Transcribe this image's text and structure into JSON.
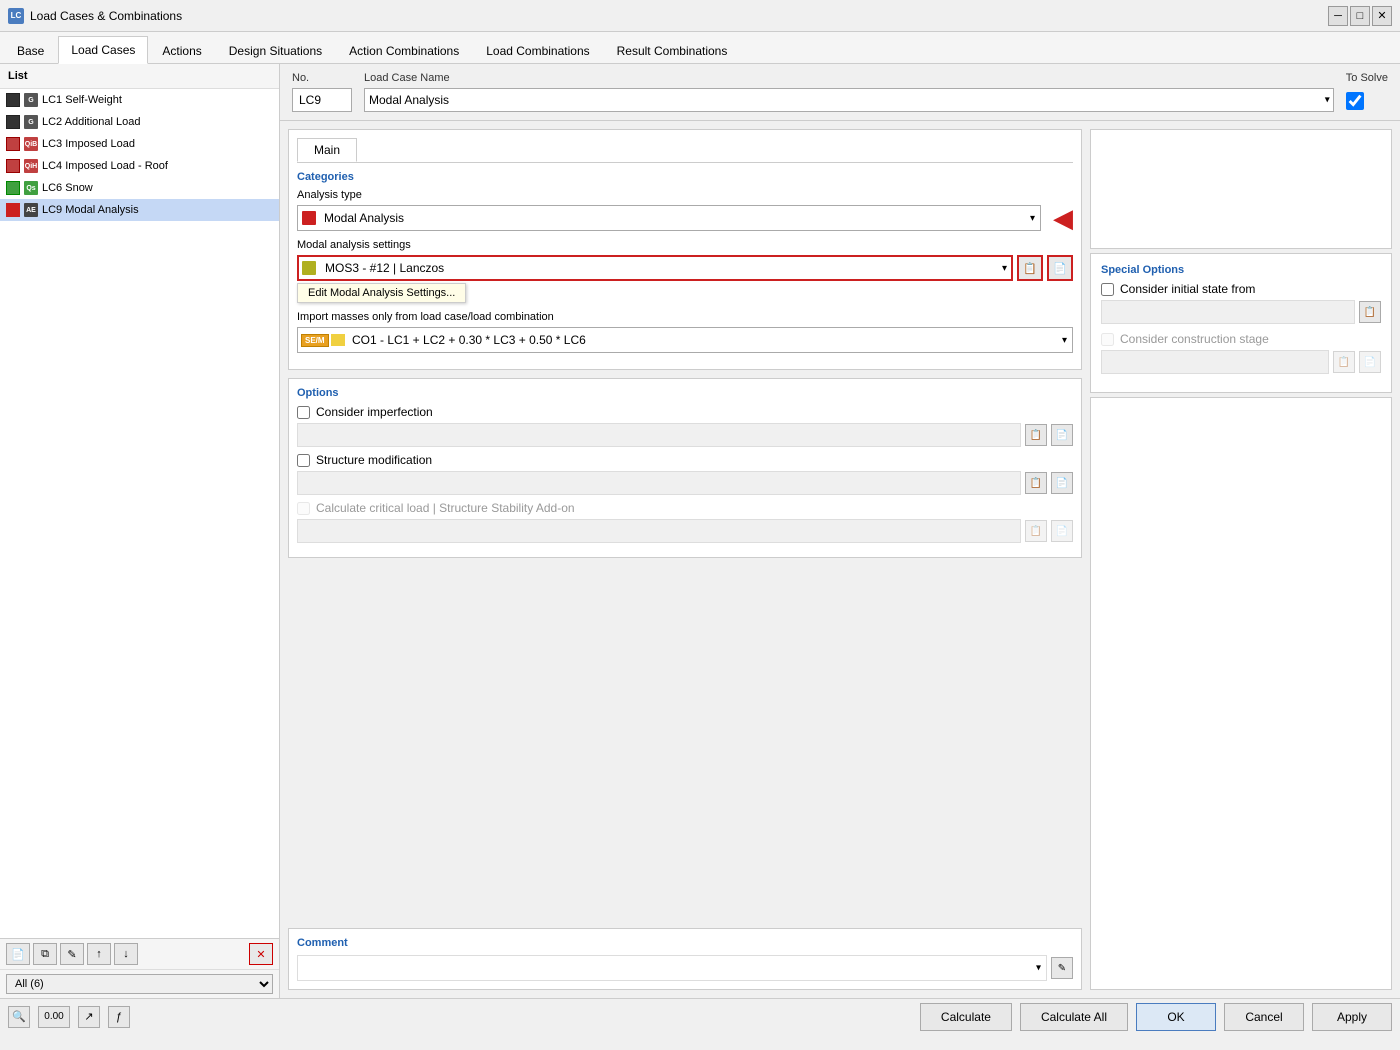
{
  "window": {
    "title": "Load Cases & Combinations",
    "icon": "LC"
  },
  "tabs": {
    "items": [
      {
        "label": "Base",
        "active": false
      },
      {
        "label": "Load Cases",
        "active": true
      },
      {
        "label": "Actions",
        "active": false
      },
      {
        "label": "Design Situations",
        "active": false
      },
      {
        "label": "Action Combinations",
        "active": false
      },
      {
        "label": "Load Combinations",
        "active": false
      },
      {
        "label": "Result Combinations",
        "active": false
      }
    ]
  },
  "list": {
    "header": "List",
    "items": [
      {
        "id": "LC1",
        "label": "LC1  Self-Weight",
        "color": "#333333",
        "tag": "G",
        "selected": false
      },
      {
        "id": "LC2",
        "label": "LC2  Additional Load",
        "color": "#333333",
        "tag": "G",
        "selected": false
      },
      {
        "id": "LC3",
        "label": "LC3  Imposed Load",
        "color": "#c04040",
        "tag": "QiB",
        "selected": false
      },
      {
        "id": "LC4",
        "label": "LC4  Imposed Load - Roof",
        "color": "#c04040",
        "tag": "QiH",
        "selected": false
      },
      {
        "id": "LC6",
        "label": "LC6  Snow",
        "color": "#40a040",
        "tag": "Qs",
        "selected": false
      },
      {
        "id": "LC9",
        "label": "LC9  Modal Analysis",
        "color": "#cc2020",
        "tag": "AE",
        "selected": true
      }
    ],
    "filter": "All (6)"
  },
  "form": {
    "no_label": "No.",
    "no_value": "LC9",
    "name_label": "Load Case Name",
    "name_value": "Modal Analysis",
    "to_solve_label": "To Solve"
  },
  "inner_tabs": [
    {
      "label": "Main",
      "active": true
    }
  ],
  "categories_label": "Categories",
  "analysis": {
    "type_label": "Analysis type",
    "type_value": "Modal Analysis",
    "settings_label": "Modal analysis settings",
    "settings_value": "MOS3 - #12 | Lanczos",
    "edit_btn": "Edit Modal Analysis Settings...",
    "import_label": "Import masses only from load case/load combination",
    "import_value": "CO1 - LC1 + LC2 + 0.30 * LC3 + 0.50 * LC6",
    "import_badge": "SE/M"
  },
  "options": {
    "header": "Options",
    "imperfection_label": "Consider imperfection",
    "imperfection_checked": false,
    "structure_label": "Structure modification",
    "structure_checked": false,
    "critical_label": "Calculate critical load | Structure Stability Add-on",
    "critical_checked": false,
    "critical_disabled": true
  },
  "special_options": {
    "header": "Special Options",
    "initial_state_label": "Consider initial state from",
    "initial_state_checked": false,
    "construction_label": "Consider construction stage",
    "construction_checked": false,
    "construction_disabled": true
  },
  "comment": {
    "label": "Comment"
  },
  "toolbar": {
    "calculate": "Calculate",
    "calculate_all": "Calculate All",
    "ok": "OK",
    "cancel": "Cancel",
    "apply": "Apply"
  },
  "bottom_icons": [
    "🔍",
    "0.00",
    "↗",
    "ƒ"
  ]
}
